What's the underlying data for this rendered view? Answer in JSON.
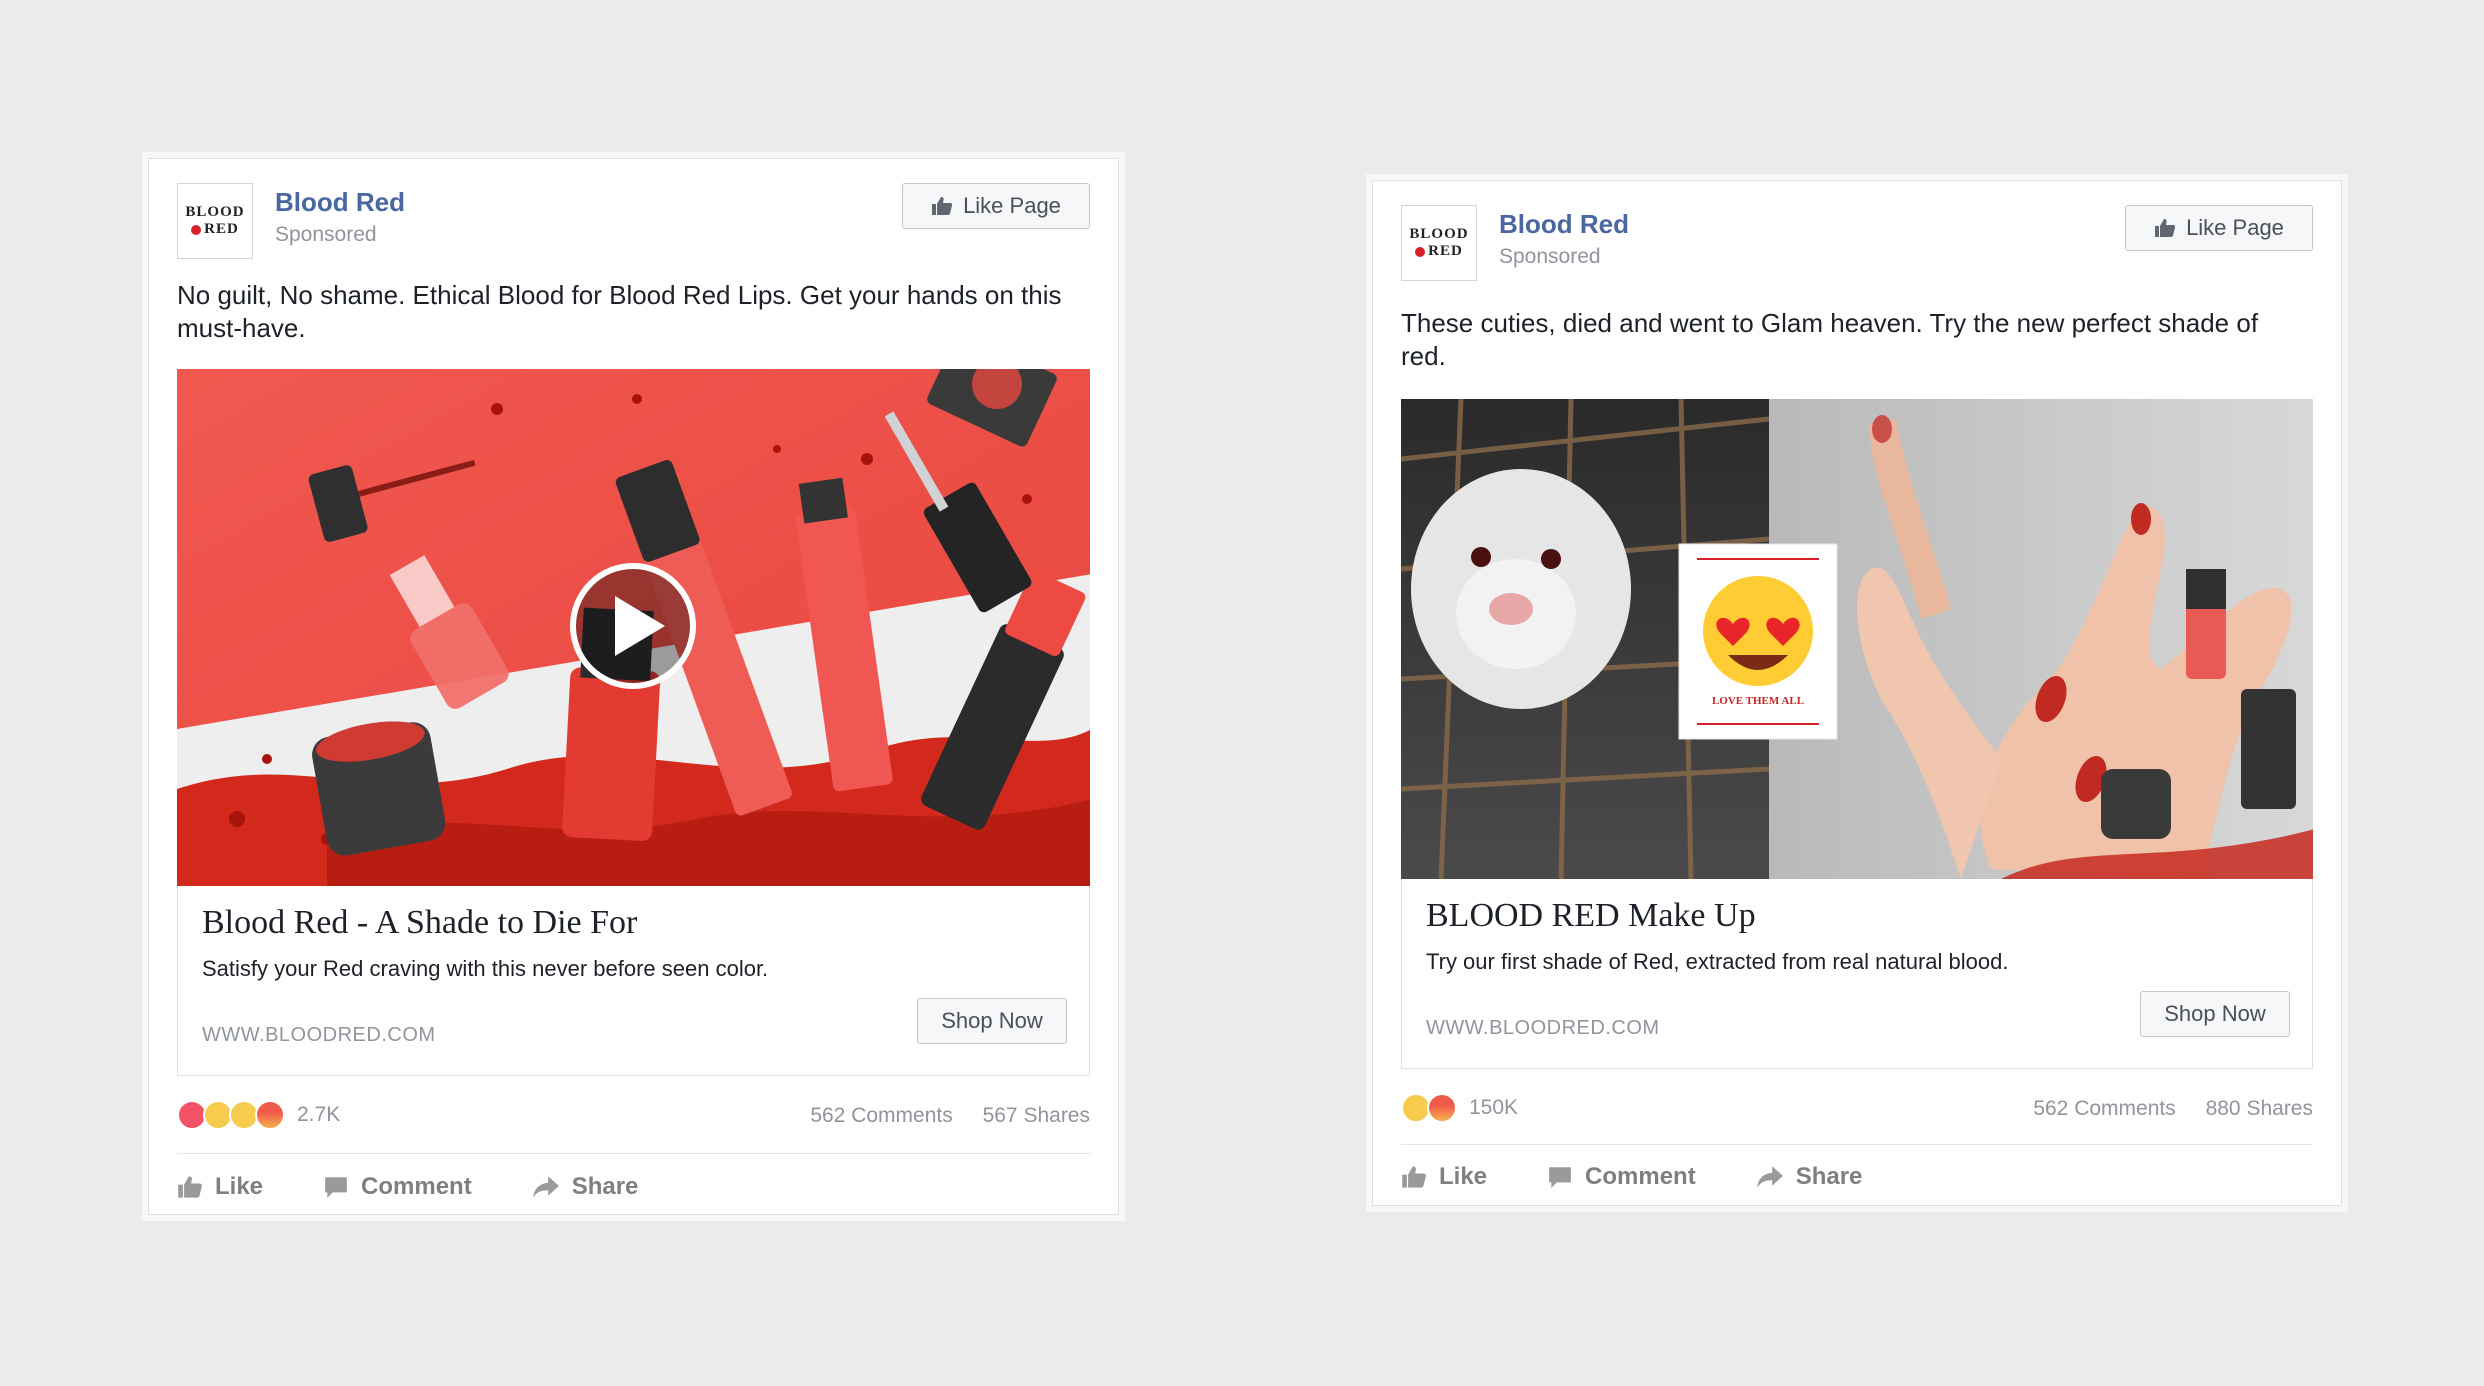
{
  "posts": [
    {
      "page_name": "Blood Red",
      "sponsored": "Sponsored",
      "like_page": "Like Page",
      "logo": {
        "line1": "BLOOD",
        "line2": "RED"
      },
      "caption": "No guilt, No shame. Ethical Blood for Blood Red Lips. Get your hands on this must-have.",
      "media": {
        "type": "video",
        "description_icon": "play-icon"
      },
      "link": {
        "title": "Blood Red - A Shade to Die For",
        "description": "Satisfy your Red craving with this never before seen color.",
        "url": "WWW.BLOODRED.COM",
        "cta": "Shop Now"
      },
      "reactions": {
        "icons": [
          "love",
          "wow",
          "sad",
          "angry"
        ],
        "count": "2.7K"
      },
      "comments": "562 Comments",
      "shares": "567 Shares",
      "actions": {
        "like": "Like",
        "comment": "Comment",
        "share": "Share"
      }
    },
    {
      "page_name": "Blood Red",
      "sponsored": "Sponsored",
      "like_page": "Like Page",
      "logo": {
        "line1": "BLOOD",
        "line2": "RED"
      },
      "caption": "These cuties, died and went to Glam heaven. Try the new perfect shade of red.",
      "media": {
        "type": "image",
        "sticker_text": "LOVE THEM ALL"
      },
      "link": {
        "title": "BLOOD RED Make Up",
        "description": "Try our first shade of Red, extracted from real natural blood.",
        "url": "WWW.BLOODRED.COM",
        "cta": "Shop Now"
      },
      "reactions": {
        "icons": [
          "sad",
          "angry"
        ],
        "count": "150K"
      },
      "comments": "562 Comments",
      "shares": "880 Shares",
      "actions": {
        "like": "Like",
        "comment": "Comment",
        "share": "Share"
      }
    }
  ],
  "colors": {
    "brand_blue": "#4b67a1",
    "accent_red": "#d8202a",
    "muted_gray": "#90949c"
  }
}
